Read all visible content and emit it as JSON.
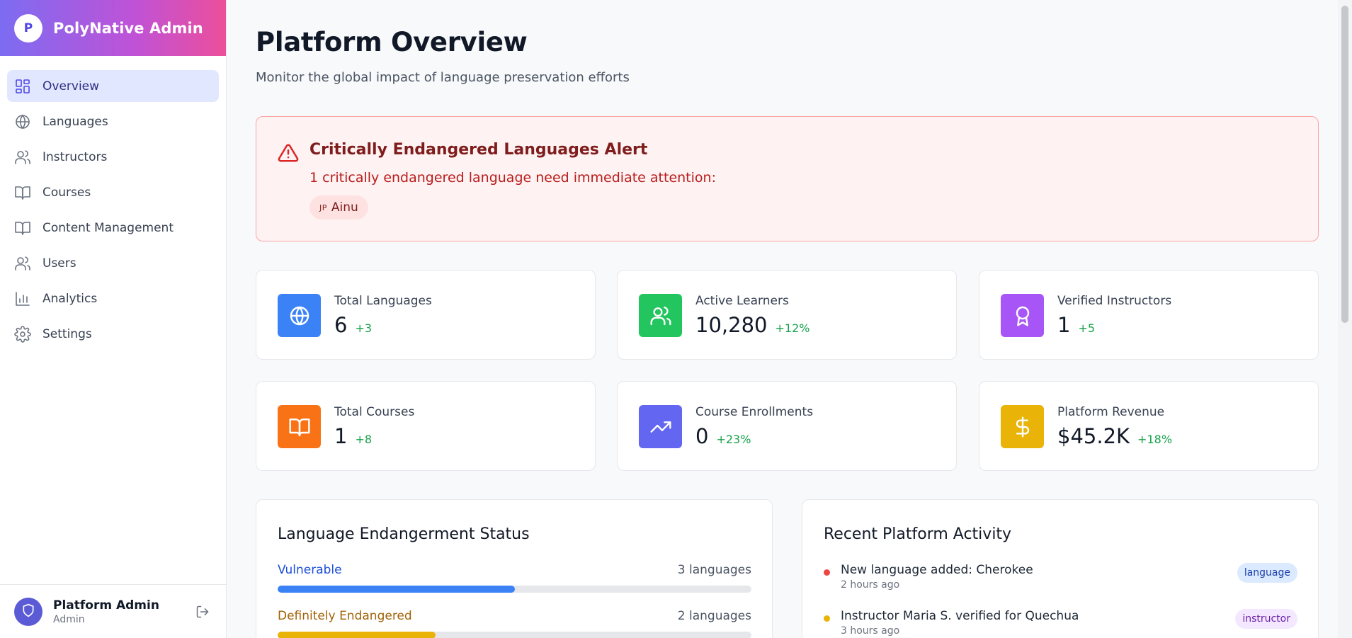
{
  "brand": {
    "avatar_letter": "P",
    "title": "PolyNative Admin"
  },
  "sidebar": {
    "items": [
      {
        "label": "Overview",
        "icon": "layout-dashboard-icon",
        "active": true
      },
      {
        "label": "Languages",
        "icon": "globe-icon"
      },
      {
        "label": "Instructors",
        "icon": "users-icon"
      },
      {
        "label": "Courses",
        "icon": "book-open-icon"
      },
      {
        "label": "Content Management",
        "icon": "book-open-icon"
      },
      {
        "label": "Users",
        "icon": "users-icon"
      },
      {
        "label": "Analytics",
        "icon": "bar-chart-icon"
      },
      {
        "label": "Settings",
        "icon": "gear-icon"
      }
    ]
  },
  "user": {
    "name": "Platform Admin",
    "role": "Admin",
    "avatar_icon": "shield-icon",
    "logout_icon": "logout-icon"
  },
  "header": {
    "title": "Platform Overview",
    "subtitle": "Monitor the global impact of language preservation efforts"
  },
  "alert": {
    "title": "Critically Endangered Languages Alert",
    "message": "1 critically endangered language need immediate attention:",
    "chips": [
      {
        "code": "JP",
        "name": "Ainu"
      }
    ]
  },
  "stats": [
    {
      "label": "Total Languages",
      "value": "6",
      "change": "+3",
      "icon": "globe-icon",
      "color": "#3b82f6"
    },
    {
      "label": "Active Learners",
      "value": "10,280",
      "change": "+12%",
      "icon": "users-icon",
      "color": "#22c55e"
    },
    {
      "label": "Verified Instructors",
      "value": "1",
      "change": "+5",
      "icon": "award-icon",
      "color": "#a855f7"
    },
    {
      "label": "Total Courses",
      "value": "1",
      "change": "+8",
      "icon": "book-open-icon",
      "color": "#f97316"
    },
    {
      "label": "Course Enrollments",
      "value": "0",
      "change": "+23%",
      "icon": "trending-up-icon",
      "color": "#6366f1"
    },
    {
      "label": "Platform Revenue",
      "value": "$45.2K",
      "change": "+18%",
      "icon": "dollar-icon",
      "color": "#eab308"
    }
  ],
  "endangerment": {
    "title": "Language Endangerment Status",
    "rows": [
      {
        "label": "Vulnerable",
        "count": "3 languages",
        "fraction": 0.5,
        "color": "#3b82f6",
        "label_color": "#1d4ed8"
      },
      {
        "label": "Definitely Endangered",
        "count": "2 languages",
        "fraction": 0.333,
        "color": "#eab308",
        "label_color": "#a16207"
      }
    ]
  },
  "activity": {
    "title": "Recent Platform Activity",
    "items": [
      {
        "text": "New language added: Cherokee",
        "time": "2 hours ago",
        "tag": "language",
        "dot": "#ef4444",
        "tag_bg": "#dbeafe",
        "tag_fg": "#1e40af"
      },
      {
        "text": "Instructor Maria S. verified for Quechua",
        "time": "3 hours ago",
        "tag": "instructor",
        "dot": "#eab308",
        "tag_bg": "#f3e8ff",
        "tag_fg": "#6b21a8"
      }
    ]
  }
}
